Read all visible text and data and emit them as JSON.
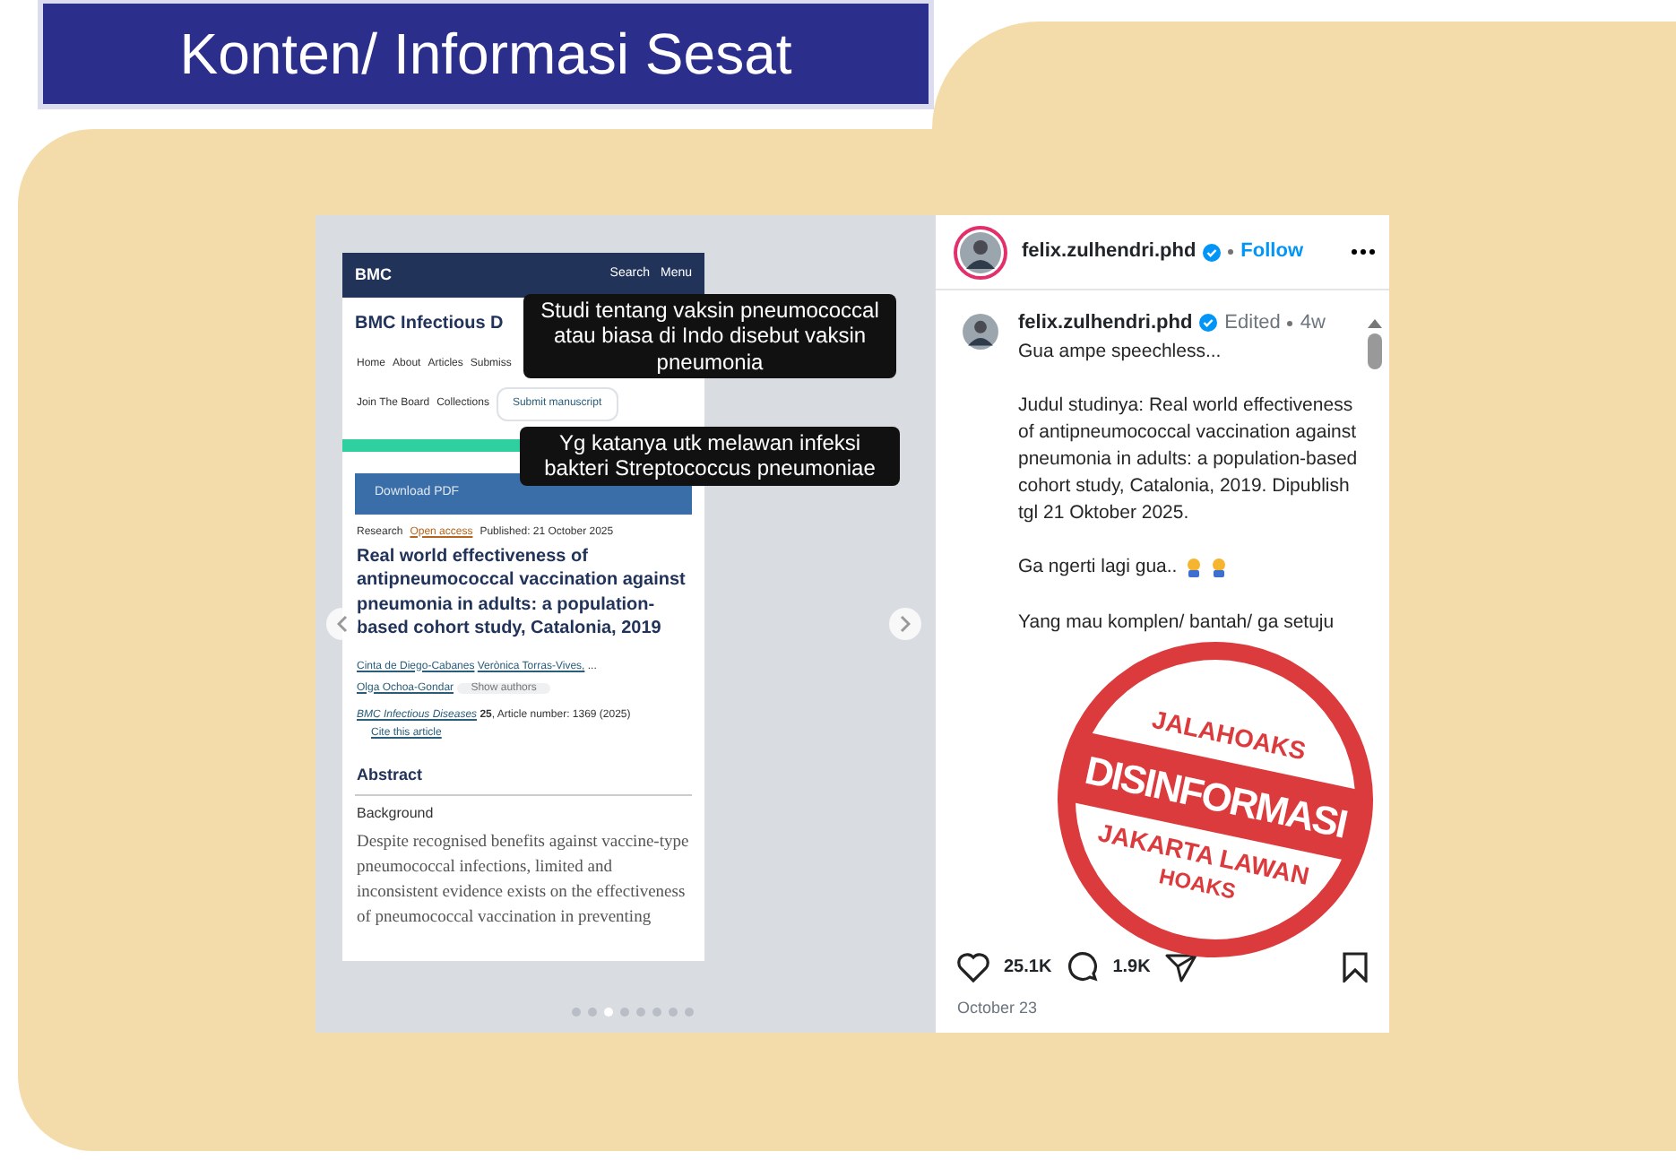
{
  "banner": {
    "title": "Konten/ Informasi Sesat"
  },
  "post": {
    "carousel": {
      "article": {
        "logo": "BMC",
        "search": "Search",
        "menu": "Menu",
        "journal": "BMC Infectious D",
        "nav_row1": [
          "Home",
          "About",
          "Articles",
          "Submiss"
        ],
        "nav_row2": [
          "Join The Board",
          "Collections"
        ],
        "submit": "Submit manuscript",
        "download": "Download PDF",
        "type": "Research",
        "access": "Open access",
        "published": "Published: 21 October 2025",
        "title": "Real world effectiveness of antipneumococcal vaccination against pneumonia in adults: a population-based cohort study, Catalonia, 2019",
        "authors": [
          "Cinta de Diego-Cabanes",
          "Verònica Torras-Vives,",
          "...",
          "Olga Ochoa-Gondar"
        ],
        "show_authors": "Show authors",
        "journal_link": "BMC Infectious Diseases",
        "volume": "25",
        "article_number": ", Article number: 1369 (2025)",
        "cite": "Cite this article",
        "abstract": "Abstract",
        "background": "Background",
        "abstract_text": "Despite recognised benefits against vaccine-type pneumococcal infections, limited and inconsistent evidence exists on the effectiveness of pneumococcal vaccination in preventing"
      },
      "captions": [
        "Studi tentang vaksin pneumococcal atau biasa di Indo disebut vaksin pneumonia",
        "Yg katanya utk melawan infeksi bakteri Streptococcus pneumoniae"
      ],
      "dots": [
        {
          "selected": false
        },
        {
          "selected": false
        },
        {
          "selected": true
        },
        {
          "selected": false
        },
        {
          "selected": false
        },
        {
          "selected": false
        },
        {
          "selected": false
        },
        {
          "selected": false
        }
      ]
    },
    "header": {
      "username": "felix.zulhendri.phd",
      "follow": "Follow"
    },
    "comment": {
      "username": "felix.zulhendri.phd",
      "edited": "Edited",
      "time": "4w",
      "lines": [
        "Gua ampe speechless...",
        "Judul studinya: Real world effectiveness of antipneumococcal vaccination against pneumonia in adults: a population-based cohort study, Catalonia, 2019. Dipublish tgl 21 Oktober 2025.",
        "Ga ngerti lagi gua..",
        "Yang mau komplen/ bantah/ ga setuju"
      ]
    },
    "likes": "25.1K",
    "comments": "1.9K",
    "date": "October 23"
  },
  "stamp": {
    "top": "JALAHOAKS",
    "main": "DISINFORMASI",
    "bottom": "JAKARTA LAWAN",
    "bottom2": "HOAKS"
  }
}
